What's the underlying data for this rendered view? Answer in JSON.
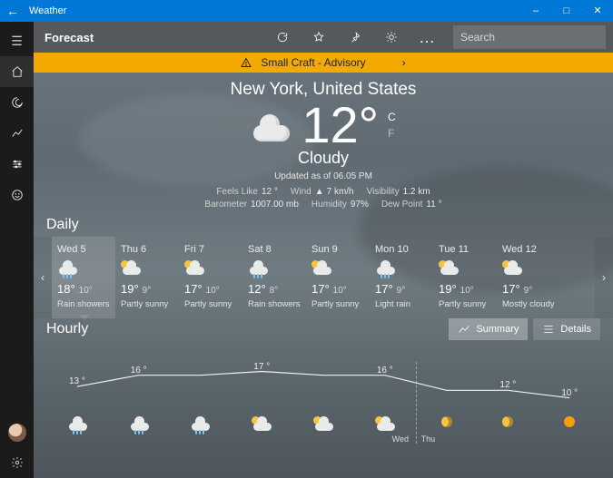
{
  "titlebar": {
    "title": "Weather"
  },
  "cmdbar": {
    "heading": "Forecast"
  },
  "search": {
    "placeholder": "Search"
  },
  "advisory": {
    "text": "Small Craft - Advisory"
  },
  "hero": {
    "location": "New York, United States",
    "temp": "12°",
    "unit_c": "C",
    "unit_f": "F",
    "condition": "Cloudy",
    "updated": "Updated as of 06.05 PM",
    "feels_label": "Feels Like",
    "feels_val": "12 °",
    "wind_label": "Wind",
    "wind_val": "7 km/h",
    "vis_label": "Visibility",
    "vis_val": "1.2 km",
    "baro_label": "Barometer",
    "baro_val": "1007.00 mb",
    "hum_label": "Humidity",
    "hum_val": "97%",
    "dew_label": "Dew Point",
    "dew_val": "11 °"
  },
  "sections": {
    "daily": "Daily",
    "hourly": "Hourly"
  },
  "hourly_toggle": {
    "summary": "Summary",
    "details": "Details"
  },
  "daily": [
    {
      "label": "Wed 5",
      "hi": "18°",
      "lo": "10°",
      "cond": "Rain showers",
      "icon": "rain",
      "selected": true
    },
    {
      "label": "Thu 6",
      "hi": "19°",
      "lo": "9°",
      "cond": "Partly sunny",
      "icon": "partly"
    },
    {
      "label": "Fri 7",
      "hi": "17°",
      "lo": "10°",
      "cond": "Partly sunny",
      "icon": "partly"
    },
    {
      "label": "Sat 8",
      "hi": "12°",
      "lo": "8°",
      "cond": "Rain showers",
      "icon": "rain"
    },
    {
      "label": "Sun 9",
      "hi": "17°",
      "lo": "10°",
      "cond": "Partly sunny",
      "icon": "partly"
    },
    {
      "label": "Mon 10",
      "hi": "17°",
      "lo": "9°",
      "cond": "Light rain",
      "icon": "rain"
    },
    {
      "label": "Tue 11",
      "hi": "19°",
      "lo": "10°",
      "cond": "Partly sunny",
      "icon": "partly"
    },
    {
      "label": "Wed 12",
      "hi": "17°",
      "lo": "9°",
      "cond": "Mostly cloudy",
      "icon": "partly"
    }
  ],
  "hourly_axis": {
    "wed": "Wed",
    "thu": "Thu"
  },
  "chart_data": {
    "type": "line",
    "title": "Hourly temperature",
    "ylabel": "°",
    "ylim": [
      8,
      20
    ],
    "x": [
      0,
      1,
      2,
      3,
      4,
      5,
      6,
      7,
      8
    ],
    "values": [
      13,
      16,
      16,
      17,
      16,
      16,
      12,
      12,
      10
    ],
    "labels": [
      "13 °",
      "16 °",
      "16 °",
      "17 °",
      "16 °",
      "16 °",
      "12 °",
      "12 °",
      "10 °"
    ],
    "label_visible": [
      true,
      true,
      false,
      true,
      false,
      true,
      false,
      true,
      true
    ],
    "icons": [
      "rain",
      "rain",
      "rain",
      "partly",
      "partly",
      "partly",
      "moon",
      "moon",
      "sun"
    ],
    "day_boundary_after_index": 5
  }
}
